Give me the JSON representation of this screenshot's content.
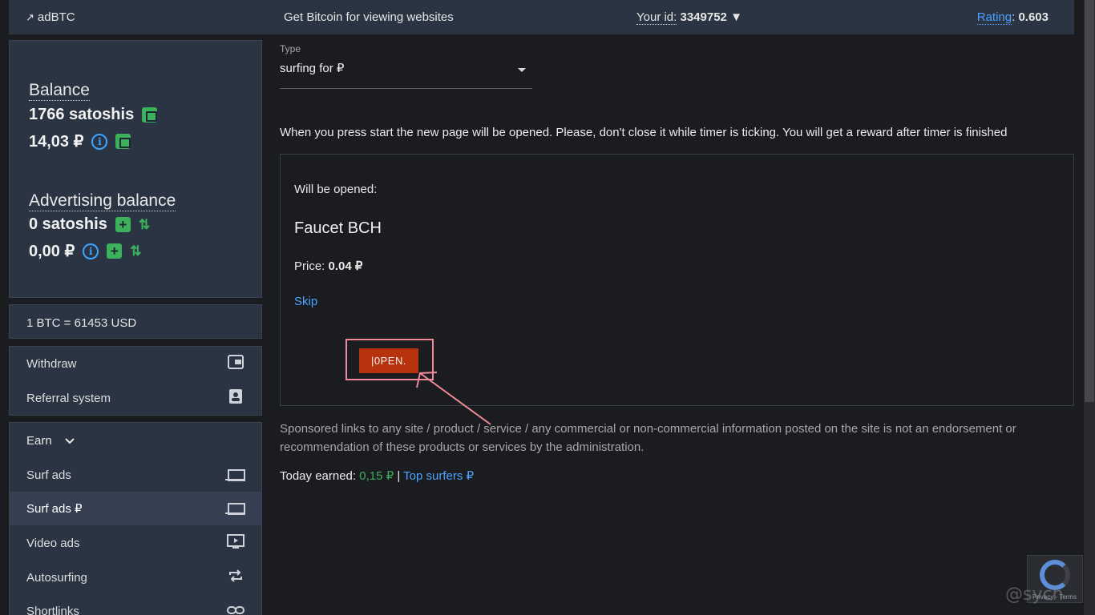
{
  "topbar": {
    "brand": "adBTC",
    "slogan": "Get Bitcoin for viewing websites",
    "user_id_label": "Your id:",
    "user_id_value": "3349752",
    "user_caret": "▼",
    "rating_label": "Rating",
    "rating_value": "0.603"
  },
  "balance": {
    "title": "Balance",
    "satoshis": "1766 satoshis",
    "rub": "14,03 ₽",
    "ad_title": "Advertising balance",
    "ad_satoshis": "0 satoshis",
    "ad_rub": "0,00 ₽"
  },
  "rate": "1 BTC = 61453 USD",
  "menu": {
    "items": [
      {
        "label": "Withdraw",
        "icon": "wallet-icon"
      },
      {
        "label": "Referral system",
        "icon": "contact-card-icon"
      }
    ]
  },
  "earn": {
    "title": "Earn",
    "items": [
      {
        "label": "Surf ads",
        "icon": "laptop-icon"
      },
      {
        "label": "Surf ads ₽",
        "icon": "laptop-icon"
      },
      {
        "label": "Video ads",
        "icon": "play-screen-icon"
      },
      {
        "label": "Autosurfing",
        "icon": "repeat-icon"
      },
      {
        "label": "Shortlinks",
        "icon": "link-icon"
      }
    ]
  },
  "main": {
    "type_label": "Type",
    "type_value": "surfing for ₽",
    "instructions": "When you press start the new page will be opened. Please, don't close it while timer is ticking. You will get a reward after timer is finished",
    "will_be_opened": "Will be opened:",
    "site_name": "Faucet BCH",
    "price_label": "Price:",
    "price_value": "0.04 ₽",
    "skip": "Skip",
    "open_button": "|0PEN.",
    "sponsored": "Sponsored links to any site / product / service / any commercial or non-commercial information posted on the site is not an endorsement or recommendation of these products or services by the administration.",
    "today_label": "Today earned:",
    "today_value": "0,15 ₽",
    "separator": "|",
    "top_surfers": "Top surfers ₽"
  },
  "recaptcha": {
    "legal": "Privacy - Terms"
  },
  "watermark": "@sych"
}
